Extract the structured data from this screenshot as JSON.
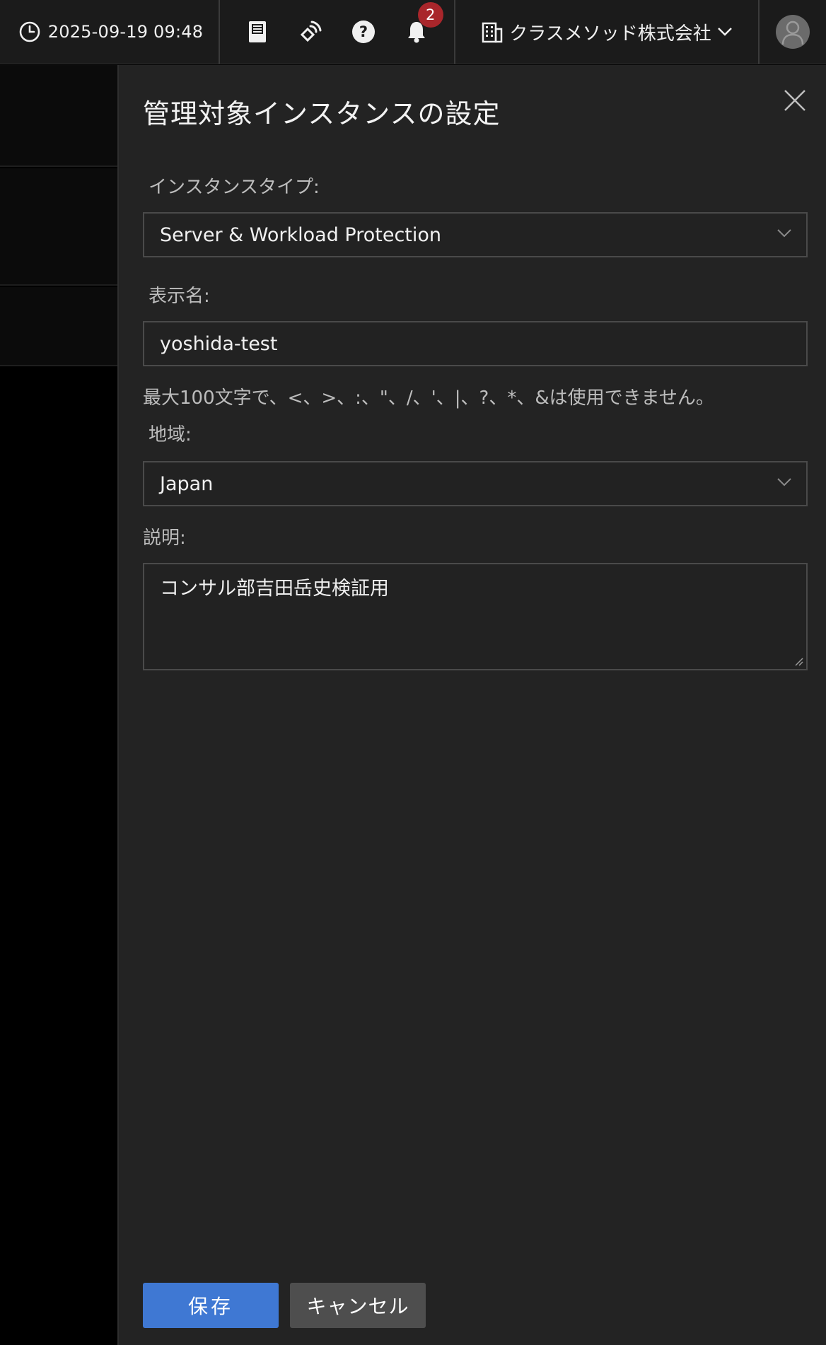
{
  "topbar": {
    "datetime": "2025-09-19 09:48",
    "notification_count": "2",
    "company": "クラスメソッド株式会社",
    "icons": [
      "clock-icon",
      "book-icon",
      "satellite-icon",
      "help-icon",
      "bell-icon",
      "building-icon",
      "chevron-down-icon",
      "avatar-icon"
    ]
  },
  "panel": {
    "title": "管理対象インスタンスの設定",
    "instance_type": {
      "label": "インスタンスタイプ:",
      "value": "Server & Workload Protection"
    },
    "display_name": {
      "label": "表示名:",
      "value": "yoshida-test",
      "hint": "最大100文字で、<、>、:、\"、/、'、|、?、*、&は使用できません。"
    },
    "region": {
      "label": "地域:",
      "value": "Japan"
    },
    "description": {
      "label": "説明:",
      "value": "コンサル部吉田岳史検証用"
    },
    "buttons": {
      "save": "保存",
      "cancel": "キャンセル"
    }
  },
  "colors": {
    "primary": "#3f78d3",
    "badge": "#a9262b",
    "panel_bg": "#232323",
    "topbar_bg": "#1b1b1b"
  }
}
